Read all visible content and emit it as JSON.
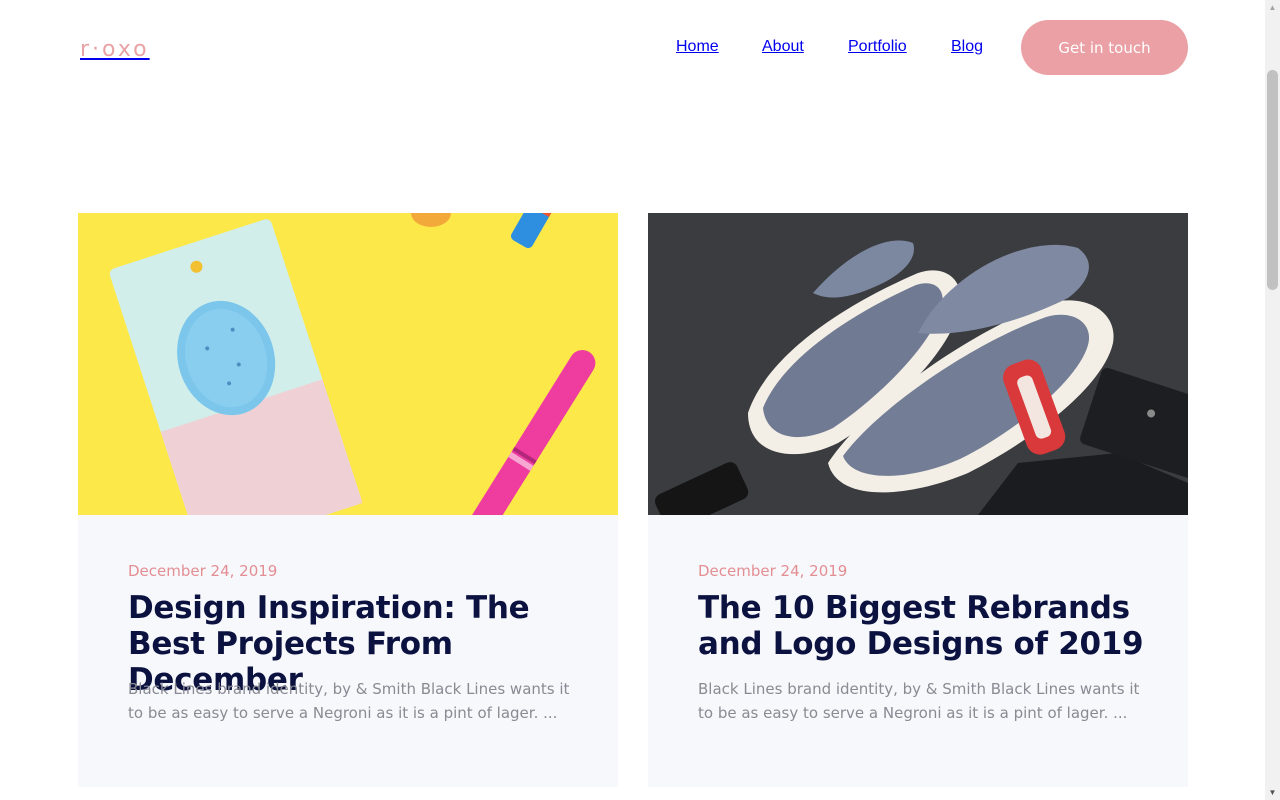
{
  "header": {
    "logo": "r·oxo",
    "nav": [
      {
        "label": "Home"
      },
      {
        "label": "About"
      },
      {
        "label": "Portfolio"
      },
      {
        "label": "Blog"
      }
    ],
    "cta_label": "Get in touch"
  },
  "posts": [
    {
      "image": "yellow-flatlay-photo",
      "date": "December 24, 2019",
      "title": "Design Inspiration: The Best Projects From December",
      "excerpt": "Black Lines brand identity, by & Smith Black Lines wants it to be as easy to serve a Negroni as it is a pint of lager. ..."
    },
    {
      "image": "sneakers-photo",
      "date": "December 24, 2019",
      "title": "The 10 Biggest Rebrands and Logo Designs of 2019",
      "excerpt": "Black Lines brand identity, by & Smith Black Lines wants it to be as easy to serve a Negroni as it is a pint of lager. ..."
    }
  ],
  "colors": {
    "accent": "#eaa0a4",
    "heading": "#0b1240",
    "card_bg": "#f7f8fc"
  }
}
